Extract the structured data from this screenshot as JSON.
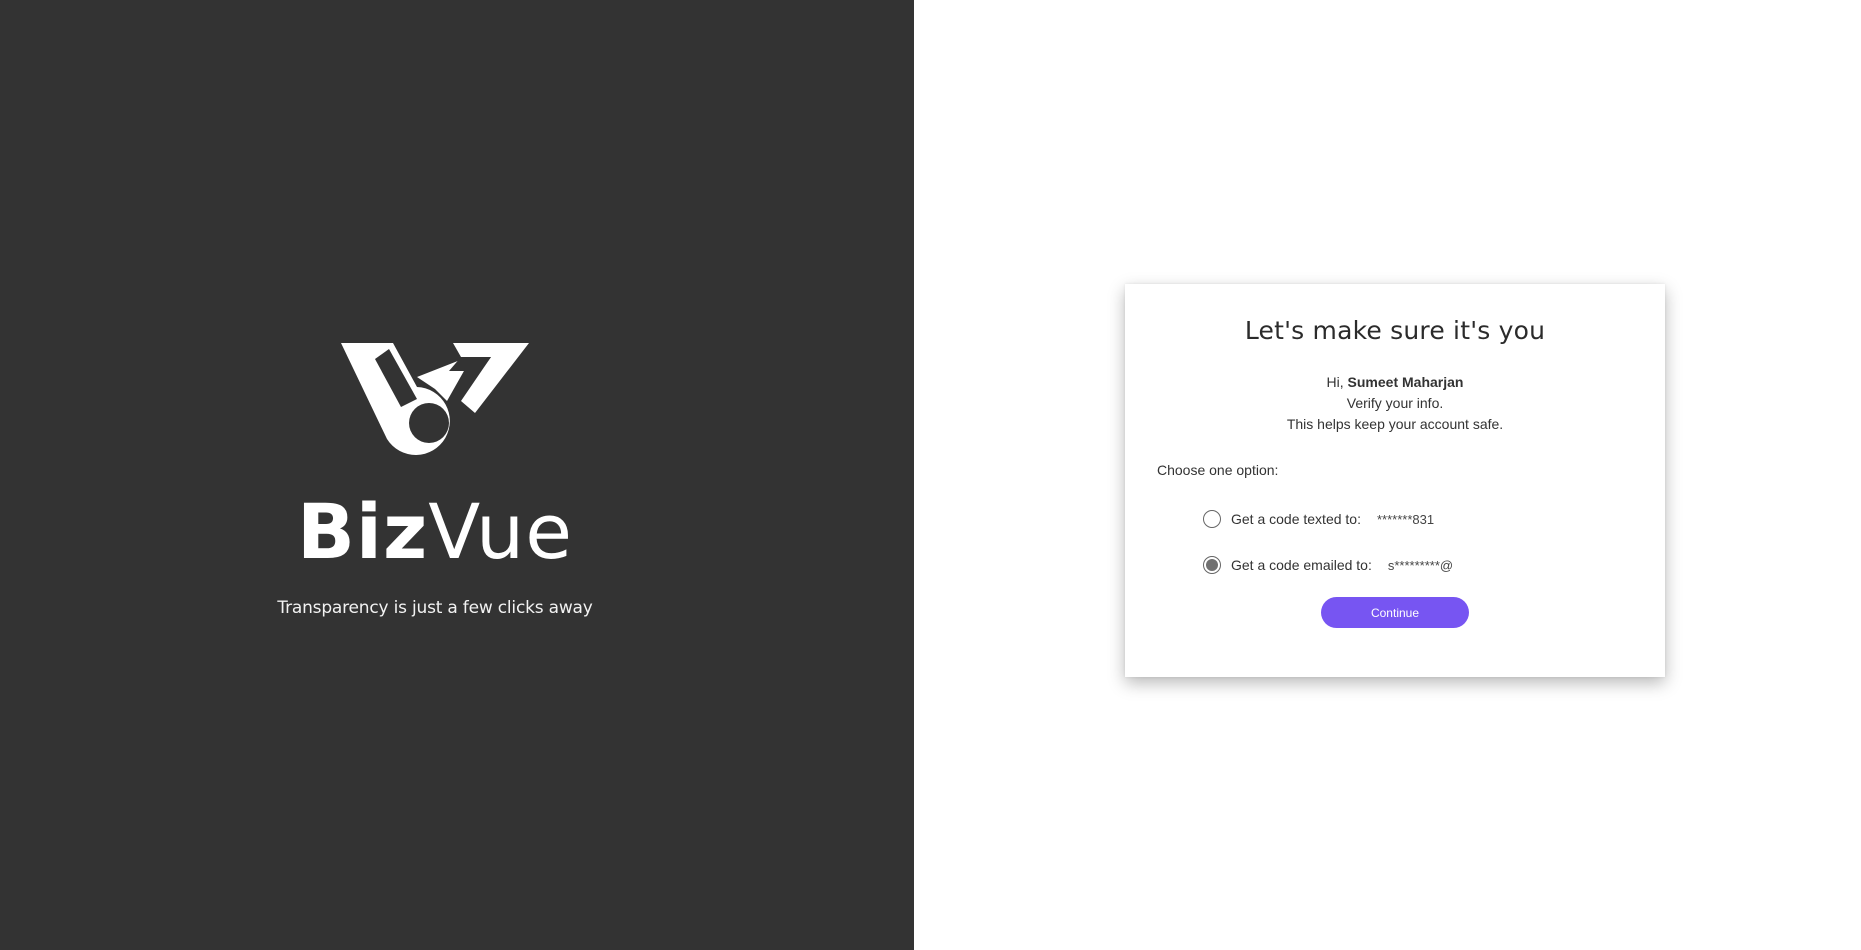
{
  "branding": {
    "logo_icon": "bizvue-logo-mark",
    "name_bold": "Biz",
    "name_light": "Vue",
    "tagline": "Transparency is just a few clicks away"
  },
  "colors": {
    "left_panel_bg": "#333333",
    "accent": "#7755f2",
    "card_bg": "#ffffff"
  },
  "verify": {
    "title": "Let's make sure it's you",
    "greeting_prefix": "Hi,",
    "user_name": "Sumeet Maharjan",
    "line2": "Verify your info.",
    "line3": "This helps keep your account safe.",
    "choose_label": "Choose one option:",
    "options": [
      {
        "label": "Get a code texted to:",
        "masked_value": "*******831",
        "selected": false
      },
      {
        "label": "Get a code emailed to:",
        "masked_value": "s*********@",
        "selected": true
      }
    ],
    "continue_label": "Continue"
  }
}
